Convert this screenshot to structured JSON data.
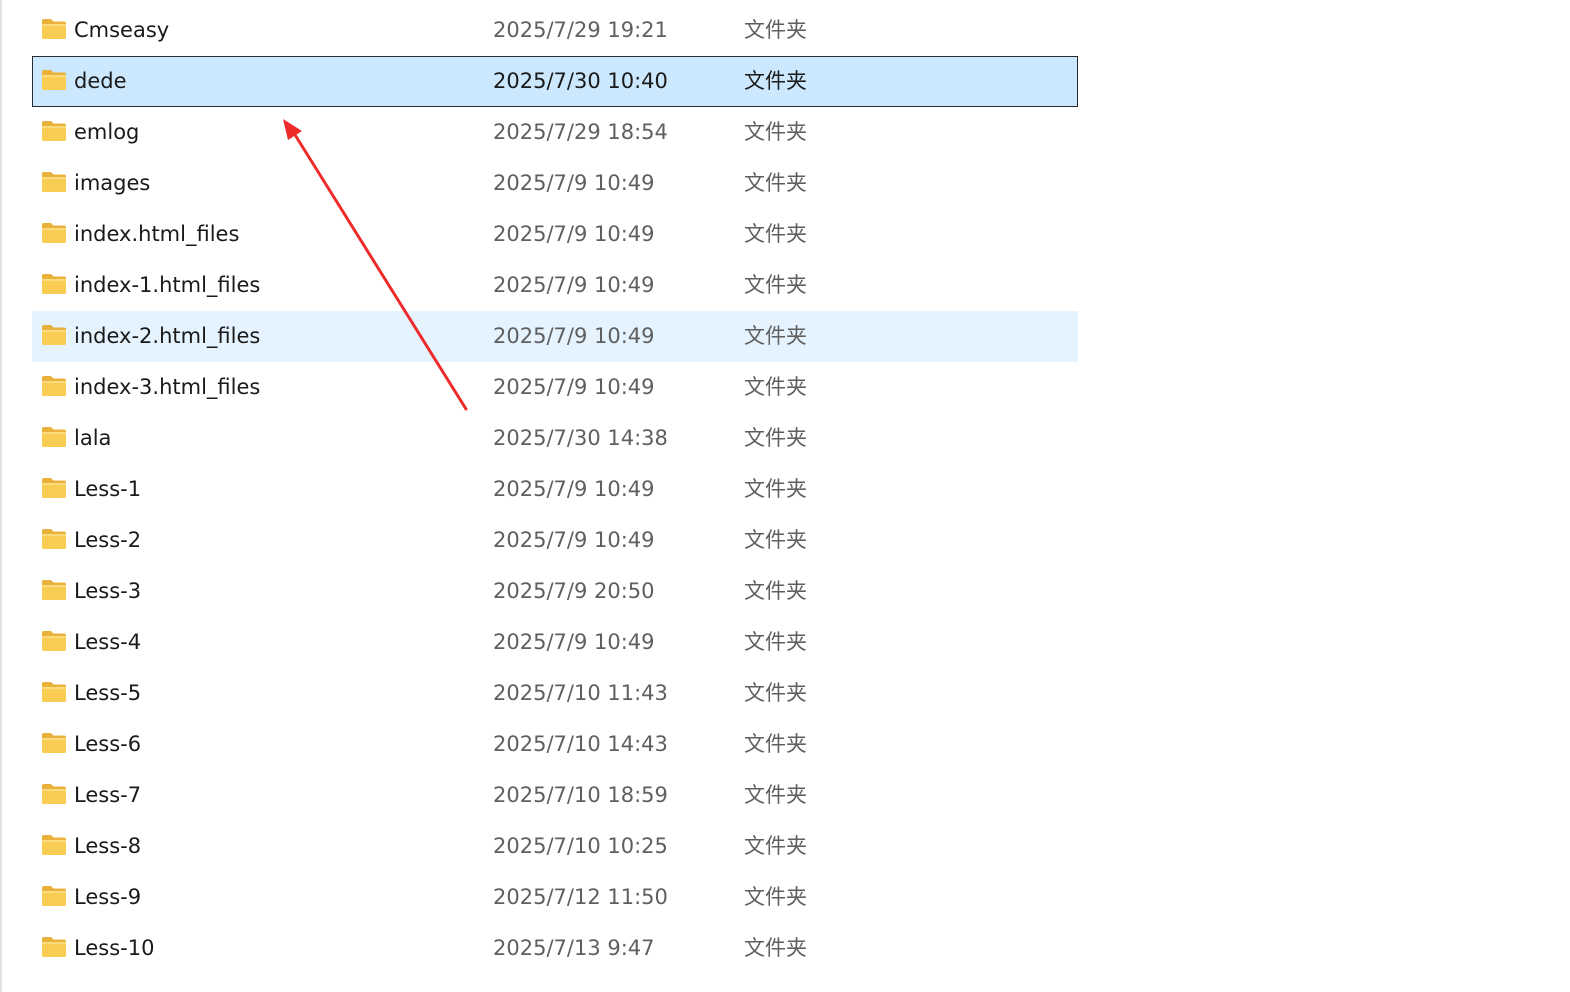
{
  "colors": {
    "selection_bg": "#cce8ff",
    "selection_border": "#2b2b2b",
    "hover_bg": "#e5f3ff",
    "folder_yellow": "#f8cd52",
    "annotation_red": "#ee2b2b"
  },
  "files": [
    {
      "name": "Cmseasy",
      "date": "2025/7/29 19:21",
      "type": "文件夹",
      "icon": "folder-icon",
      "state": "normal"
    },
    {
      "name": "dede",
      "date": "2025/7/30 10:40",
      "type": "文件夹",
      "icon": "folder-icon",
      "state": "selected"
    },
    {
      "name": "emlog",
      "date": "2025/7/29 18:54",
      "type": "文件夹",
      "icon": "folder-icon",
      "state": "normal"
    },
    {
      "name": "images",
      "date": "2025/7/9 10:49",
      "type": "文件夹",
      "icon": "folder-icon",
      "state": "normal"
    },
    {
      "name": "index.html_files",
      "date": "2025/7/9 10:49",
      "type": "文件夹",
      "icon": "folder-icon",
      "state": "normal"
    },
    {
      "name": "index-1.html_files",
      "date": "2025/7/9 10:49",
      "type": "文件夹",
      "icon": "folder-icon",
      "state": "normal"
    },
    {
      "name": "index-2.html_files",
      "date": "2025/7/9 10:49",
      "type": "文件夹",
      "icon": "folder-icon",
      "state": "hover"
    },
    {
      "name": "index-3.html_files",
      "date": "2025/7/9 10:49",
      "type": "文件夹",
      "icon": "folder-icon",
      "state": "normal"
    },
    {
      "name": "lala",
      "date": "2025/7/30 14:38",
      "type": "文件夹",
      "icon": "folder-icon",
      "state": "normal"
    },
    {
      "name": "Less-1",
      "date": "2025/7/9 10:49",
      "type": "文件夹",
      "icon": "folder-icon",
      "state": "normal"
    },
    {
      "name": "Less-2",
      "date": "2025/7/9 10:49",
      "type": "文件夹",
      "icon": "folder-icon",
      "state": "normal"
    },
    {
      "name": "Less-3",
      "date": "2025/7/9 20:50",
      "type": "文件夹",
      "icon": "folder-icon",
      "state": "normal"
    },
    {
      "name": "Less-4",
      "date": "2025/7/9 10:49",
      "type": "文件夹",
      "icon": "folder-icon",
      "state": "normal"
    },
    {
      "name": "Less-5",
      "date": "2025/7/10 11:43",
      "type": "文件夹",
      "icon": "folder-icon",
      "state": "normal"
    },
    {
      "name": "Less-6",
      "date": "2025/7/10 14:43",
      "type": "文件夹",
      "icon": "folder-icon",
      "state": "normal"
    },
    {
      "name": "Less-7",
      "date": "2025/7/10 18:59",
      "type": "文件夹",
      "icon": "folder-icon",
      "state": "normal"
    },
    {
      "name": "Less-8",
      "date": "2025/7/10 10:25",
      "type": "文件夹",
      "icon": "folder-icon",
      "state": "normal"
    },
    {
      "name": "Less-9",
      "date": "2025/7/12 11:50",
      "type": "文件夹",
      "icon": "folder-icon",
      "state": "normal"
    },
    {
      "name": "Less-10",
      "date": "2025/7/13 9:47",
      "type": "文件夹",
      "icon": "folder-icon",
      "state": "normal"
    }
  ]
}
